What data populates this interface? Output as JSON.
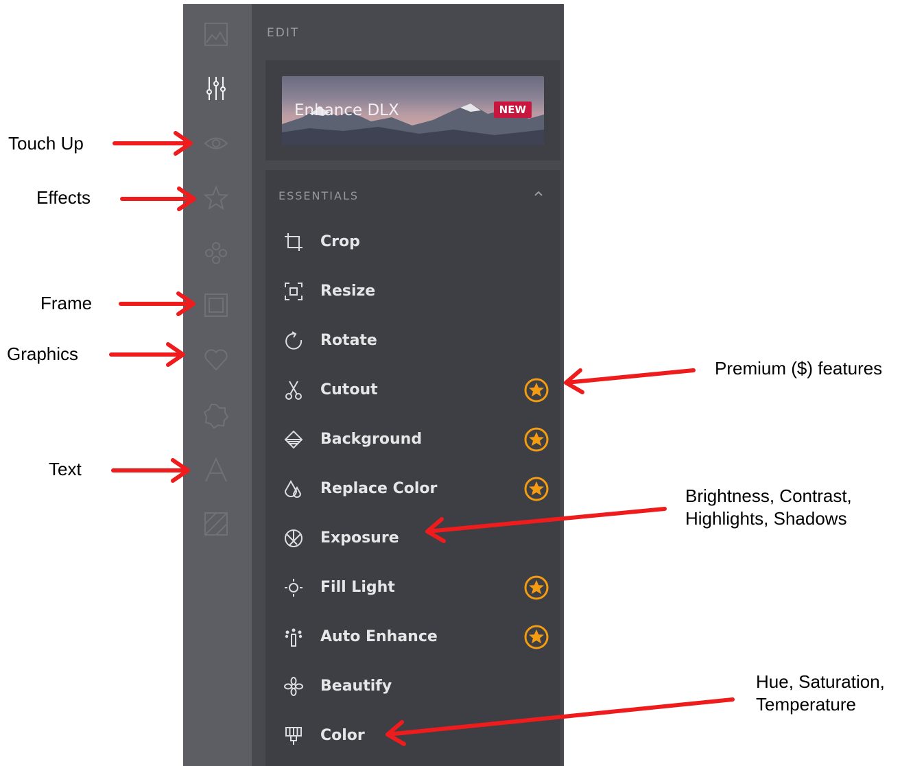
{
  "panel": {
    "title": "EDIT",
    "banner": {
      "label": "Enhance DLX",
      "badge": "NEW"
    },
    "essentials": {
      "header": "ESSENTIALS",
      "tools": [
        {
          "label": "Crop",
          "icon": "crop-icon",
          "premium": false
        },
        {
          "label": "Resize",
          "icon": "resize-icon",
          "premium": false
        },
        {
          "label": "Rotate",
          "icon": "rotate-icon",
          "premium": false
        },
        {
          "label": "Cutout",
          "icon": "scissors-icon",
          "premium": true
        },
        {
          "label": "Background",
          "icon": "background-icon",
          "premium": true
        },
        {
          "label": "Replace Color",
          "icon": "drops-icon",
          "premium": true
        },
        {
          "label": "Exposure",
          "icon": "aperture-icon",
          "premium": false
        },
        {
          "label": "Fill Light",
          "icon": "fill-light-icon",
          "premium": true
        },
        {
          "label": "Auto Enhance",
          "icon": "magic-wand-icon",
          "premium": true
        },
        {
          "label": "Beautify",
          "icon": "flower-icon",
          "premium": false
        },
        {
          "label": "Color",
          "icon": "color-icon",
          "premium": false
        }
      ]
    }
  },
  "sidebar_icons": [
    "image-icon",
    "sliders-icon",
    "eye-icon",
    "star-icon",
    "circles-icon",
    "frame-icon",
    "heart-icon",
    "badge-icon",
    "text-icon",
    "texture-icon"
  ],
  "annotations": {
    "touch_up": "Touch Up",
    "effects": "Effects",
    "frame": "Frame",
    "graphics": "Graphics",
    "text": "Text",
    "premium": "Premium ($) features",
    "exposure_line1": "Brightness, Contrast,",
    "exposure_line2": "Highlights, Shadows",
    "color_line1": "Hue, Saturation,",
    "color_line2": "Temperature"
  },
  "colors": {
    "arrow": "#ee1c1c",
    "premium": "#f39c12",
    "badge": "#c8163e"
  }
}
